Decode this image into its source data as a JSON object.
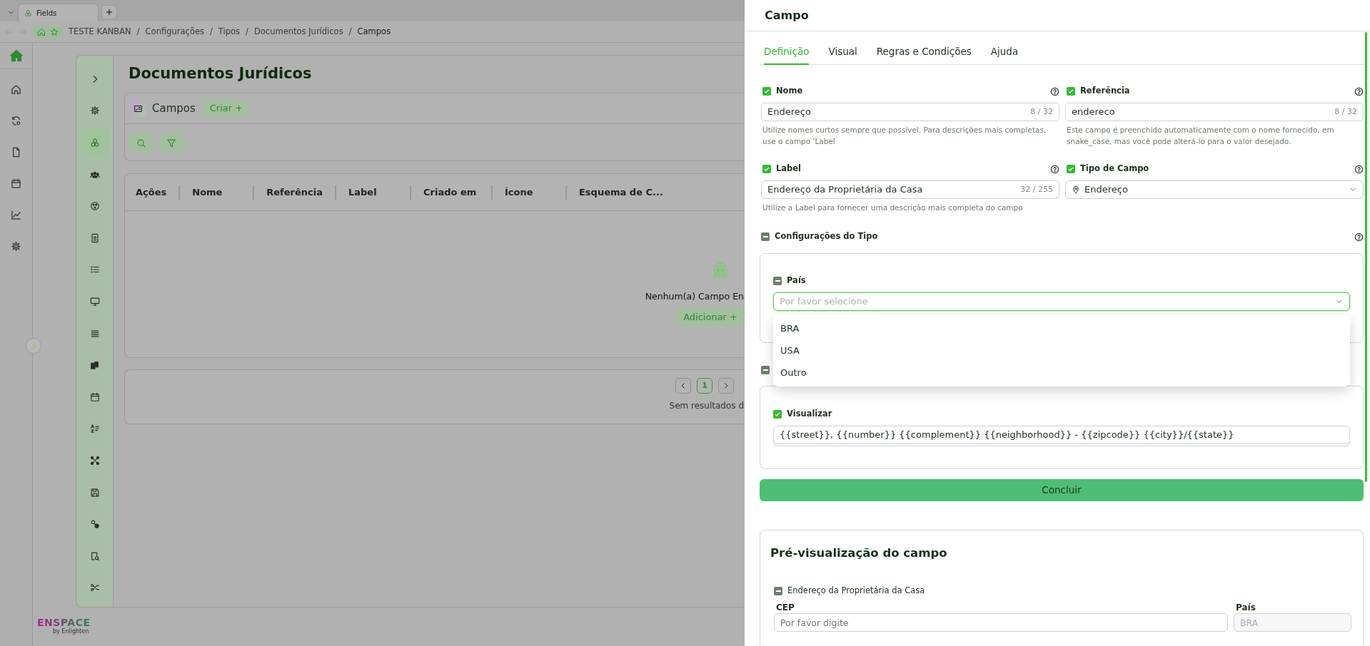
{
  "browser": {
    "tab_title": "Fields",
    "separator": "/",
    "breadcrumb": [
      {
        "label": "TESTE KANBAN",
        "current": false
      },
      {
        "label": "Configurações",
        "current": false
      },
      {
        "label": "Tipos",
        "current": false
      },
      {
        "label": "Documentos Jurídicos",
        "current": false
      },
      {
        "label": "Campos",
        "current": true
      }
    ]
  },
  "page": {
    "title": "Documentos Jurídicos",
    "section": {
      "title": "Campos",
      "create_button": "Criar +"
    },
    "table": {
      "columns": [
        "Ações",
        "Nome",
        "Referência",
        "Label",
        "Criado em",
        "Ícone",
        "Esquema de C..."
      ]
    },
    "empty_state": {
      "message": "Nenhum(a) Campo En",
      "add_button": "Adicionar +"
    },
    "pagination": {
      "pages": [
        {
          "label": "1",
          "selected": true
        }
      ],
      "summary": "Sem resultados d"
    }
  },
  "brand": {
    "logo": "ENSPACE",
    "tagline": "by Enlighten"
  },
  "drawer": {
    "title": "Campo",
    "tabs": [
      {
        "label": "Definição",
        "selected": true
      },
      {
        "label": "Visual",
        "selected": false
      },
      {
        "label": "Regras e Condições",
        "selected": false
      },
      {
        "label": "Ajuda",
        "selected": false
      }
    ],
    "fields": [
      {
        "kind": "text",
        "label": "Nome",
        "checked": true,
        "value": "Endereço",
        "counter": "8 / 32",
        "help": "Utilize nomes curtos sempre que possível. Para descrições mais completas, use o campo 'Label"
      },
      {
        "kind": "text",
        "label": "Referência",
        "checked": true,
        "value": "endereco",
        "counter": "8 / 32",
        "help": "Este campo é preenchido automaticamente com o nome fornecido, em snake_case, mas você pode alterá-lo para o valor desejado."
      },
      {
        "kind": "text",
        "label": "Label",
        "checked": true,
        "value": "Endereço da Proprietária da Casa",
        "counter": "32 / 255",
        "help": "Utilize a Label para fornecer uma descrição mais completa do campo"
      },
      {
        "kind": "select",
        "label": "Tipo de Campo",
        "checked": true,
        "value": "Endereço"
      }
    ],
    "type_config": {
      "title": "Configurações do Tipo",
      "expanded": true,
      "country": {
        "label": "País",
        "expanded": true,
        "placeholder": "Por favor selecione",
        "open": true,
        "options": [
          {
            "label": "BRA",
            "selected": false
          },
          {
            "label": "USA",
            "selected": false
          },
          {
            "label": "Outro",
            "selected": false
          }
        ]
      }
    },
    "display_config": {
      "expanded": true,
      "preview": {
        "label": "Visualizar",
        "checked": true,
        "value": "{{street}}, {{number}} {{complement}} {{neighborhood}} - {{zipcode}} {{city}}/{{state}}"
      }
    },
    "submit": "Concluir",
    "preview": {
      "title": "Pré-visualização do campo",
      "group": {
        "label": "Endereço da Proprietária da Casa",
        "expanded": true
      },
      "fields": [
        {
          "label": "CEP",
          "placeholder": "Por favor digite",
          "disabled": false
        },
        {
          "label": "País",
          "value": "BRA",
          "disabled": true
        }
      ]
    }
  }
}
